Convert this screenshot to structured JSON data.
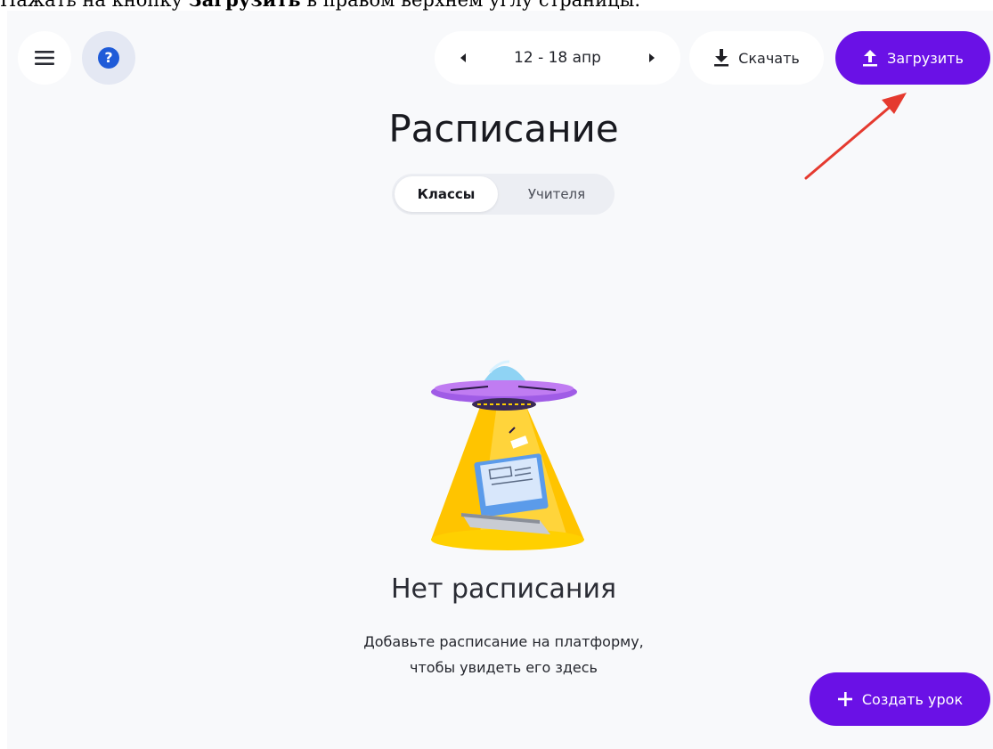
{
  "caption": {
    "prefix": "Нажать на кнопку ",
    "bold": "Загрузить",
    "suffix": " в правом верхнем углу страницы."
  },
  "header": {
    "menu_icon": "hamburger-menu-icon",
    "help_icon": "question-icon",
    "week": {
      "label": "12 - 18 апр",
      "prev_icon": "caret-left-icon",
      "next_icon": "caret-right-icon"
    },
    "download_label": "Скачать",
    "download_icon": "download-icon",
    "upload_label": "Загрузить",
    "upload_icon": "upload-icon"
  },
  "main": {
    "title": "Расписание",
    "tabs": [
      {
        "label": "Классы",
        "active": true
      },
      {
        "label": "Учителя",
        "active": false
      }
    ],
    "empty_state": {
      "illustration": "ufo-illustration",
      "title": "Нет расписания",
      "description_line1": "Добавьте расписание на платформу,",
      "description_line2": "чтобы увидеть его здесь"
    }
  },
  "fab": {
    "label": "Создать урок",
    "icon": "plus-icon"
  },
  "colors": {
    "accent": "#6a11e6",
    "help_blue": "#1f5bd8",
    "background": "#f8f9fb",
    "annotation_arrow": "#e53a2f"
  }
}
